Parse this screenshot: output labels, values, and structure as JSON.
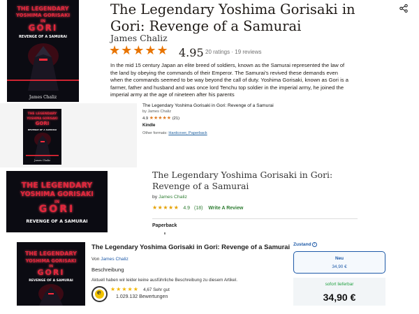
{
  "cover": {
    "line1": "THE LEGENDARY",
    "line2": "YOSHIMA GORISAKI",
    "line3": "IN",
    "line4": "GORI",
    "subtitle": "REVENGE OF A SAMURAI",
    "author": "James Chaliz"
  },
  "panel1": {
    "title": "The Legendary Yoshima Gorisaki in Gori: Revenge of a Samurai",
    "author": "James Chaliz",
    "stars": "★★★★★",
    "rating": "4.95",
    "counts": "20 ratings · 19 reviews",
    "description": "In the mid 15 century Japan an elite breed of soldiers, known as the Samurai represented the law of the land by obeying the commands of their Emperor. The Samurai's revived these demands even when the commands seemed to be way beyond the call of duty. Yoshima Gorisaki, known as Gori is a farmer, father and husband and was once lord Tenchu top soldier in the imperial army, he joined the imperial army at the age of nineteen after his parents"
  },
  "panel2": {
    "title": "The Legendary Yoshima Gorisaki in Gori: Revenge of a Samurai",
    "by": "by James Chaliz",
    "rating": "4.9",
    "stars": "★★★★★",
    "count": "(21)",
    "format": "Kindle",
    "other_label": "Other formats:",
    "other_link": "Hardcover, Paperback"
  },
  "panel3": {
    "title": "The Legendary Yoshima Gorisaki in Gori: Revenge of a Samurai",
    "by_prefix": "by",
    "author": "James Chaliz",
    "stars": "★★★★★",
    "rating": "4.9",
    "count": "(18)",
    "review_link": "Write A Review",
    "format": "Paperback"
  },
  "panel4": {
    "title": "The Legendary Yoshima Gorisaki in Gori: Revenge of a Samurai",
    "von_prefix": "Von",
    "author": "James Chaliz",
    "description_heading": "Beschreibung",
    "description": "Aktuell haben wir leider keine ausführliche Beschreibung zu diesem Artikel.",
    "stars": "★★★★★",
    "rating": "4,67 Sehr gut",
    "reviews": "1.029.132 Bewertungen",
    "condition_label": "Zustand",
    "info_icon": "i",
    "badge_letter": "e",
    "option_name": "Neu",
    "option_price": "34,90 €",
    "availability": "sofort lieferbar",
    "price": "34,90 €"
  },
  "colors": {
    "amazon_star": "#de7921",
    "goodreads_star": "#e87400",
    "green": "#2e7d32",
    "blue": "#1e5aa8",
    "cover_red": "#e3263c"
  }
}
